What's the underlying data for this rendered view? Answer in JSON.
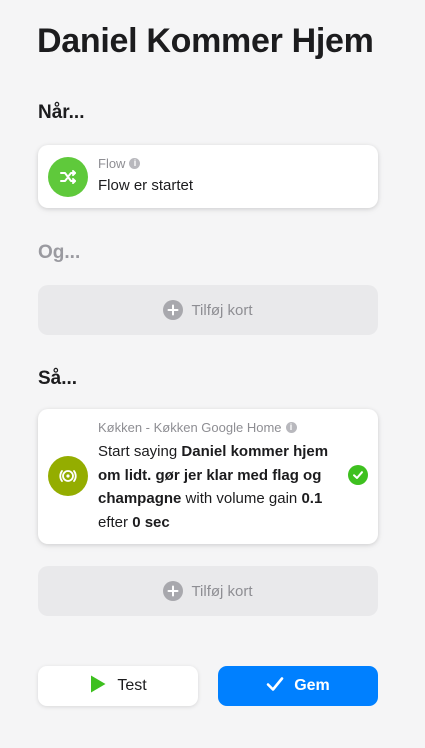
{
  "page": {
    "title": "Daniel Kommer Hjem"
  },
  "when": {
    "label": "Når...",
    "card": {
      "source": "Flow",
      "text": "Flow er startet",
      "icon": "shuffle-icon",
      "icon_color": "#5fc93b"
    }
  },
  "and": {
    "label": "Og...",
    "add_card_label": "Tilføj kort"
  },
  "then": {
    "label": "Så...",
    "card": {
      "source": "Køkken - Køkken Google Home",
      "icon": "google-home-speaker-icon",
      "icon_color": "#94ad00",
      "parts": {
        "p1": "Start saying",
        "speech": "Daniel kommer hjem om lidt. gør jer klar med flag og champagne",
        "p2": "with volume gain",
        "volume": "0.1",
        "p3": "efter",
        "delay": "0 sec"
      },
      "status": "check-icon",
      "status_color": "#3ec01f"
    },
    "add_card_label": "Tilføj kort"
  },
  "buttons": {
    "test_label": "Test",
    "save_label": "Gem",
    "test_icon_color": "#3ec01f",
    "save_color": "#0080ff"
  }
}
